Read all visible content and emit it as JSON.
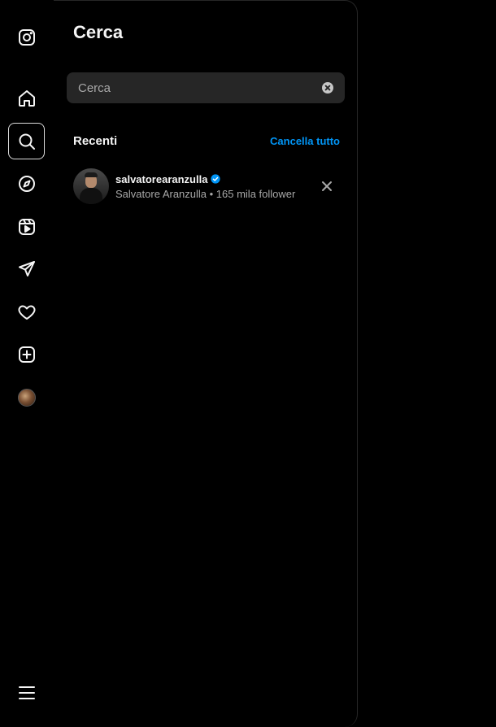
{
  "panel": {
    "title": "Cerca",
    "search": {
      "placeholder": "Cerca",
      "value": ""
    },
    "recent": {
      "section_title": "Recenti",
      "clear_all_label": "Cancella tutto",
      "items": [
        {
          "username": "salvatorearanzulla",
          "verified": true,
          "subtitle": "Salvatore Aranzulla • 165 mila follower"
        }
      ]
    }
  },
  "rail": {
    "icons": [
      "instagram-icon",
      "home-icon",
      "search-icon",
      "explore-icon",
      "reels-icon",
      "messages-icon",
      "notifications-icon",
      "create-icon",
      "profile-avatar",
      "menu-icon"
    ],
    "active": "search-icon"
  },
  "colors": {
    "background": "#000000",
    "input_bg": "#262626",
    "accent": "#0095f6",
    "verified": "#0095f6",
    "secondary_text": "#a8a8a8"
  }
}
